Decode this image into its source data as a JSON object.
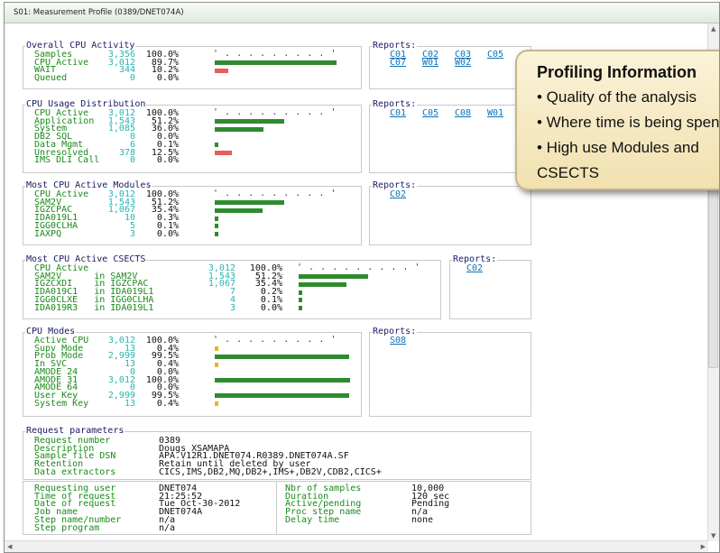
{
  "window": {
    "title": "S01: Measurement Profile (0389/DNET074A)"
  },
  "overall": {
    "title": "Overall CPU Activity",
    "rows": [
      {
        "label": "Samples",
        "value": "3,356",
        "pct": "100.0%"
      },
      {
        "label": "CPU Active",
        "value": "3,012",
        "pct": "89.7%",
        "fraction": 0.897,
        "color": "#2e8b2e"
      },
      {
        "label": "WAIT",
        "value": "344",
        "pct": "10.2%",
        "fraction": 0.102,
        "color": "#e85d5d"
      },
      {
        "label": "Queued",
        "value": "0",
        "pct": "0.0%"
      }
    ],
    "reports_label": "Reports:",
    "reports": [
      "C01",
      "C02",
      "C03",
      "C05",
      "C07",
      "W01",
      "W02"
    ]
  },
  "usage": {
    "title": "CPU Usage Distribution",
    "rows": [
      {
        "label": "CPU Active",
        "value": "3,012",
        "pct": "100.0%"
      },
      {
        "label": "Application",
        "value": "1,543",
        "pct": "51.2%",
        "fraction": 0.512,
        "color": "#2e8b2e"
      },
      {
        "label": "System",
        "value": "1,085",
        "pct": "36.0%",
        "fraction": 0.36,
        "color": "#2e8b2e"
      },
      {
        "label": "DB2 SQL",
        "value": "0",
        "pct": "0.0%"
      },
      {
        "label": "Data Mgmt",
        "value": "6",
        "pct": "0.1%",
        "fraction": 0.001,
        "color": "#2e8b2e"
      },
      {
        "label": "Unresolved",
        "value": "378",
        "pct": "12.5%",
        "fraction": 0.125,
        "color": "#e85d5d"
      },
      {
        "label": "IMS DLI Call",
        "value": "0",
        "pct": "0.0%"
      }
    ],
    "reports_label": "Reports:",
    "reports": [
      "C01",
      "C05",
      "C08",
      "W01"
    ]
  },
  "modules": {
    "title": "Most CPU Active Modules",
    "rows": [
      {
        "label": "CPU Active",
        "value": "3,012",
        "pct": "100.0%"
      },
      {
        "label": "SAM2V",
        "value": "1,543",
        "pct": "51.2%",
        "fraction": 0.512,
        "color": "#2e8b2e"
      },
      {
        "label": "IGZCPAC",
        "value": "1,067",
        "pct": "35.4%",
        "fraction": 0.354,
        "color": "#2e8b2e"
      },
      {
        "label": "IDA019L1",
        "value": "10",
        "pct": "0.3%",
        "fraction": 0.003,
        "color": "#2e8b2e"
      },
      {
        "label": "IGG0CLHA",
        "value": "5",
        "pct": "0.1%",
        "fraction": 0.001,
        "color": "#2e8b2e"
      },
      {
        "label": "IAXPQ",
        "value": "3",
        "pct": "0.0%",
        "fraction": 0.0,
        "color": "#2e8b2e"
      }
    ],
    "reports_label": "Reports:",
    "reports": [
      "C02"
    ]
  },
  "csects": {
    "title": "Most CPU Active CSECTS",
    "rows": [
      {
        "label": "CPU Active",
        "value": "3,012",
        "pct": "100.0%"
      },
      {
        "label": "SAM2V      in SAM2V",
        "value": "1,543",
        "pct": "51.2%",
        "fraction": 0.512,
        "color": "#2e8b2e"
      },
      {
        "label": "IGZCXDI    in IGZCPAC",
        "value": "1,067",
        "pct": "35.4%",
        "fraction": 0.354,
        "color": "#2e8b2e"
      },
      {
        "label": "IDA019C1   in IDA019L1",
        "value": "7",
        "pct": "0.2%",
        "fraction": 0.002,
        "color": "#2e8b2e"
      },
      {
        "label": "IGG0CLXE   in IGG0CLHA",
        "value": "4",
        "pct": "0.1%",
        "fraction": 0.001,
        "color": "#2e8b2e"
      },
      {
        "label": "IDA019R3   in IDA019L1",
        "value": "3",
        "pct": "0.0%",
        "fraction": 0.0,
        "color": "#2e8b2e"
      }
    ],
    "reports_label": "Reports:",
    "reports": [
      "C02"
    ]
  },
  "modes": {
    "title": "CPU Modes",
    "rows": [
      {
        "label": "Active CPU",
        "value": "3,012",
        "pct": "100.0%"
      },
      {
        "label": "Supv Mode",
        "value": "13",
        "pct": "0.4%",
        "fraction": 0.004,
        "color": "#f0b21b"
      },
      {
        "label": "Prob Mode",
        "value": "2,999",
        "pct": "99.5%",
        "fraction": 0.995,
        "color": "#2e8b2e"
      },
      {
        "label": "In SVC",
        "value": "13",
        "pct": "0.4%",
        "fraction": 0.004,
        "color": "#f0b21b"
      },
      {
        "label": "AMODE 24",
        "value": "0",
        "pct": "0.0%"
      },
      {
        "label": "AMODE 31",
        "value": "3,012",
        "pct": "100.0%",
        "fraction": 1.0,
        "color": "#2e8b2e"
      },
      {
        "label": "AMODE 64",
        "value": "0",
        "pct": "0.0%"
      },
      {
        "label": "User Key",
        "value": "2,999",
        "pct": "99.5%",
        "fraction": 0.995,
        "color": "#2e8b2e"
      },
      {
        "label": "System Key",
        "value": "13",
        "pct": "0.4%",
        "fraction": 0.004,
        "color": "#f0b21b"
      }
    ],
    "reports_label": "Reports:",
    "reports": [
      "S08"
    ]
  },
  "request": {
    "title": "Request parameters",
    "rows": [
      {
        "label": "Request number",
        "value": "0389"
      },
      {
        "label": "Description",
        "value": "Dougs XSAMAPA"
      },
      {
        "label": "Sample file DSN",
        "value": "APA.V12R1.DNET074.R0389.DNET074A.SF"
      },
      {
        "label": "Retention",
        "value": "Retain until deleted by user"
      },
      {
        "label": "Data extractors",
        "value": "CICS,IMS,DB2,MQ,DB2+,IMS+,DB2V,CDB2,CICS+"
      }
    ],
    "left": [
      {
        "label": "Requesting user",
        "value": "DNET074"
      },
      {
        "label": "Time of request",
        "value": "21:25:52"
      },
      {
        "label": "Date of request",
        "value": "Tue Oct-30-2012"
      },
      {
        "label": "Job name",
        "value": "DNET074A"
      },
      {
        "label": "Step name/number",
        "value": "n/a"
      },
      {
        "label": "Step program",
        "value": "n/a"
      }
    ],
    "right": [
      {
        "label": "Nbr of samples",
        "value": "10,000"
      },
      {
        "label": "Duration",
        "value": "120 sec"
      },
      {
        "label": "Active/pending",
        "value": "Pending"
      },
      {
        "label": "Proc step name",
        "value": "n/a"
      },
      {
        "label": "Delay time",
        "value": "none"
      }
    ]
  },
  "popup": {
    "title": "Profiling Information",
    "lines": [
      "• Quality of the analysis",
      "• Where time is being spent",
      "• High use Modules and",
      "CSECTS"
    ]
  },
  "scale_ticks": "' . . . . . . . . . '"
}
